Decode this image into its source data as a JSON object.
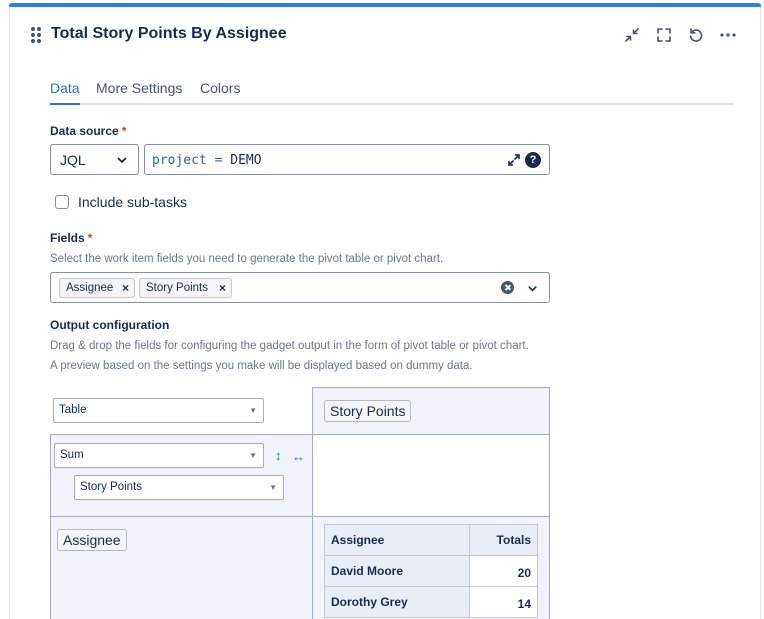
{
  "gadget": {
    "title": "Total Story Points By Assignee",
    "actions": [
      "minimize",
      "fullscreen",
      "refresh",
      "more"
    ]
  },
  "tabs": [
    {
      "label": "Data",
      "active": true
    },
    {
      "label": "More Settings",
      "active": false
    },
    {
      "label": "Colors",
      "active": false
    }
  ],
  "data_source": {
    "label": "Data source",
    "required_mark": "*",
    "type_value": "JQL",
    "jql_field": "project",
    "jql_operator": "=",
    "jql_value": "DEMO",
    "help_glyph": "?"
  },
  "include_subtasks": {
    "label": "Include sub-tasks",
    "checked": false
  },
  "fields": {
    "label": "Fields",
    "required_mark": "*",
    "helper": "Select the work item fields you need to generate the pivot table or pivot chart.",
    "selected": [
      "Assignee",
      "Story Points"
    ],
    "remove_glyph": "×"
  },
  "output": {
    "label": "Output configuration",
    "helper_1": "Drag & drop the fields for configuring the gadget output in the form of pivot table or pivot chart.",
    "helper_2": "A preview based on the settings you make will be displayed based on dummy data.",
    "view_type": "Table",
    "aggregation": "Sum",
    "aggregation_field": "Story Points",
    "column_field": "Story Points",
    "row_field": "Assignee",
    "swap_vertical": "↕",
    "swap_horizontal": "↔",
    "select_arrow": "▼"
  },
  "preview_table": {
    "headers": [
      "Assignee",
      "Totals"
    ],
    "rows": [
      {
        "name": "David Moore",
        "total": "20"
      },
      {
        "name": "Dorothy Grey",
        "total": "14"
      }
    ]
  },
  "colors": {
    "accent": "#2f7de1",
    "link": "#2f6fd6",
    "required": "#de350b",
    "text": "#172b4d",
    "cell_tint": "#f0f4fa"
  }
}
